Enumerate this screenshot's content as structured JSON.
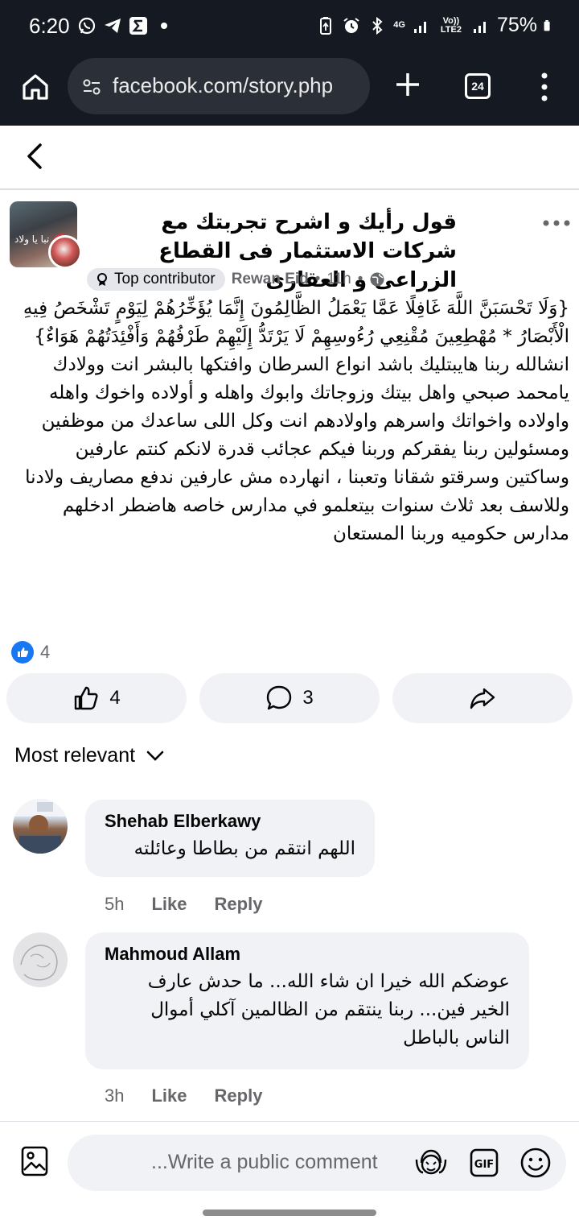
{
  "status_bar": {
    "time": "6:20",
    "network_top": "4G",
    "network_volte": "Vo)) LTE2",
    "battery": "75%"
  },
  "browser": {
    "url": "facebook.com/story.php",
    "tab_count": "24"
  },
  "post": {
    "title": "قول رأيك و اشرح تجربتك مع شركات الاستثمار فى القطاع الزراعى و العقارى",
    "badge": "Top contributor",
    "author": "Rewan Eid",
    "time": "11h",
    "dot": "•",
    "avatar_text": "تبا يا ولاد",
    "body_quote": "{وَلَا تَحْسَبَنَّ اللَّهَ غَافِلًا عَمَّا يَعْمَلُ الظَّالِمُونَ إِنَّمَا يُؤَخِّرُهُمْ لِيَوْمٍ تَشْخَصُ فِيهِ الْأَبْصَارُ * مُهْطِعِينَ مُقْنِعِي رُءُوسِهِمْ لَا يَرْتَدُّ إِلَيْهِمْ طَرْفُهُمْ وَأَفْئِدَتُهُمْ هَوَاءٌ}",
    "body_text": "انشالله ربنا هايبتليك باشد انواع السرطان وافتكها بالبشر انت وولادك يامحمد صبحي واهل بيتك وزوجاتك وابوك واهله و أولاده واخوك واهله واولاده واخواتك واسرهم واولادهم انت وكل اللى ساعدك من موظفين ومسئولين ربنا يفقركم وربنا فيكم عجائب قدرة لانكم كنتم عارفين وساكتين وسرقتو شقانا وتعبنا ، انهارده مش عارفين ندفع مصاريف ولادنا وللاسف بعد ثلاث سنوات بيتعلمو في مدارس خاصه هاضطر ادخلهم مدارس حكوميه وربنا المستعان"
  },
  "reactions": {
    "count": "4"
  },
  "actions": {
    "like_count": "4",
    "comment_count": "3"
  },
  "sort": {
    "label": "Most relevant"
  },
  "comments": [
    {
      "name": "Shehab Elberkawy",
      "text": "اللهم انتقم من بطاطا وعائلته",
      "time": "5h",
      "like": "Like",
      "reply": "Reply"
    },
    {
      "name": "Mahmoud Allam",
      "text": "عوضكم الله خيرا ان شاء الله... ما حدش عارف الخير فين... ربنا ينتقم من الظالمين آكلي أموال الناس بالباطل",
      "time": "3h",
      "like": "Like",
      "reply": "Reply"
    }
  ],
  "composer": {
    "placeholder": "...Write a public comment"
  },
  "icons": {
    "home": "home-icon",
    "tune": "tune-icon",
    "plus": "plus-icon",
    "tabs": "tabs-icon",
    "menu": "more-vert-icon",
    "back": "back-arrow-icon",
    "more": "more-horiz-icon",
    "globe": "globe-icon",
    "like": "thumbs-up-icon",
    "comment": "comment-icon",
    "share": "share-icon",
    "chevron": "chevron-down-icon",
    "photo": "photo-icon",
    "gif": "gif-icon",
    "emoji": "emoji-icon",
    "avatar_sticker": "avatar-sticker-icon"
  },
  "colors": {
    "status_bg": "#151a22",
    "accent": "#1877f2",
    "bubble": "#f0f2f5",
    "muted": "#65676b"
  }
}
